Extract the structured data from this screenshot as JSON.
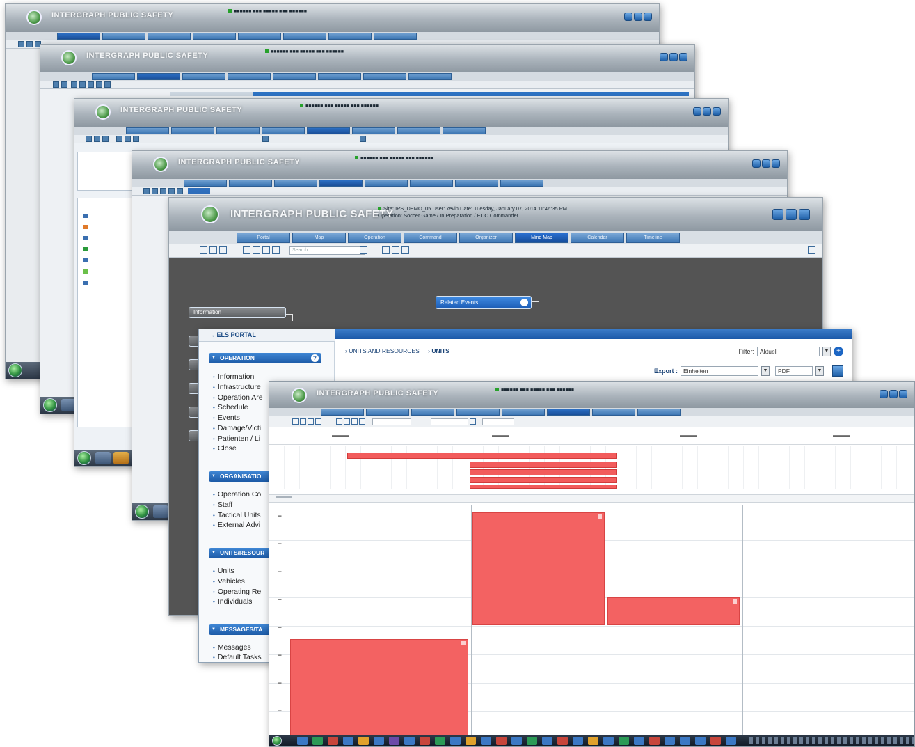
{
  "windows": {
    "w5": {
      "brand": "INTERGRAPH PUBLIC SAFETY",
      "status_line1": "Site: IPS_DEMO_05  User: kevin  Date: Tuesday, January 07, 2014 11:46:35 PM",
      "status_line2": "Operation: Soccer Game  /  In Preparation  /  EOC Commander",
      "tabs": [
        "Portal",
        "Map",
        "Operation",
        "Command",
        "Organizer",
        "Mind Map",
        "Calendar",
        "Timeline"
      ],
      "active_tab": "Mind Map",
      "search_placeholder": "Search",
      "mindmap": {
        "root_node": "Related Events",
        "side_node": "Information"
      }
    },
    "els": {
      "portal_link": "ELS PORTAL",
      "breadcrumb": [
        "UNITS AND RESOURCES",
        "UNITS"
      ],
      "filter_label": "Filter:",
      "filter_value": "Aktuell",
      "export_label": "Export :",
      "export_value": "Einheiten",
      "export_format": "PDF",
      "sections": [
        {
          "title": "OPERATION",
          "items": [
            "Information",
            "Infrastructure",
            "Operation Are",
            "Schedule",
            "Events",
            "Damage/Victi",
            "Patienten / Li",
            "Close"
          ]
        },
        {
          "title": "ORGANISATIO",
          "items": [
            "Operation Co",
            "Staff",
            "Tactical Units",
            "External Advi"
          ]
        },
        {
          "title": "UNITS/RESOUR",
          "items": [
            "Units",
            "Vehicles",
            "Operating Re",
            "Individuals"
          ]
        },
        {
          "title": "MESSAGES/TA",
          "items": [
            "Messages",
            "Default Tasks"
          ]
        }
      ]
    }
  },
  "colors": {
    "accent_blue": "#1c5aa6",
    "event_red": "#f36262",
    "mindmap_bg": "#545454",
    "status_green": "#27a12b"
  },
  "icons": [
    "search-icon",
    "help-icon",
    "add-icon",
    "export-icon",
    "window-buttons",
    "start-orb"
  ]
}
